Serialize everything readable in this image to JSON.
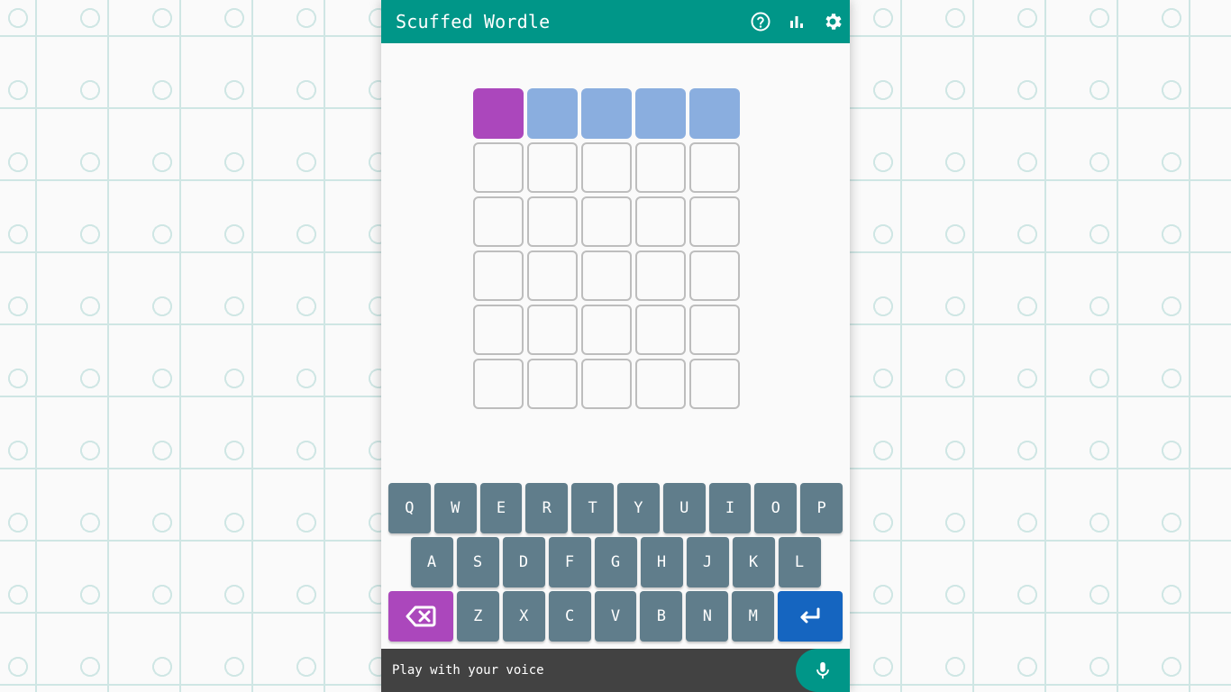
{
  "header": {
    "title": "Scuffed Wordle",
    "icons": [
      "help-icon",
      "stats-icon",
      "settings-icon"
    ]
  },
  "board": {
    "rows": [
      [
        {
          "letter": "",
          "color": "#ab47bc"
        },
        {
          "letter": "",
          "color": "#8aaedf"
        },
        {
          "letter": "",
          "color": "#8aaedf"
        },
        {
          "letter": "",
          "color": "#8aaedf"
        },
        {
          "letter": "",
          "color": "#8aaedf"
        }
      ],
      [
        {
          "letter": ""
        },
        {
          "letter": ""
        },
        {
          "letter": ""
        },
        {
          "letter": ""
        },
        {
          "letter": ""
        }
      ],
      [
        {
          "letter": ""
        },
        {
          "letter": ""
        },
        {
          "letter": ""
        },
        {
          "letter": ""
        },
        {
          "letter": ""
        }
      ],
      [
        {
          "letter": ""
        },
        {
          "letter": ""
        },
        {
          "letter": ""
        },
        {
          "letter": ""
        },
        {
          "letter": ""
        }
      ],
      [
        {
          "letter": ""
        },
        {
          "letter": ""
        },
        {
          "letter": ""
        },
        {
          "letter": ""
        },
        {
          "letter": ""
        }
      ],
      [
        {
          "letter": ""
        },
        {
          "letter": ""
        },
        {
          "letter": ""
        },
        {
          "letter": ""
        },
        {
          "letter": ""
        }
      ]
    ]
  },
  "keyboard": {
    "row1": [
      "Q",
      "W",
      "E",
      "R",
      "T",
      "Y",
      "U",
      "I",
      "O",
      "P"
    ],
    "row2": [
      "A",
      "S",
      "D",
      "F",
      "G",
      "H",
      "J",
      "K",
      "L"
    ],
    "row3": [
      "Z",
      "X",
      "C",
      "V",
      "B",
      "N",
      "M"
    ],
    "backspace_icon": "backspace-icon",
    "enter_icon": "enter-icon"
  },
  "voice": {
    "label": "Play with your voice",
    "icon": "microphone-icon"
  },
  "colors": {
    "header": "#009688",
    "key": "#607d8b",
    "backspace": "#ab47bc",
    "enter": "#1565c0",
    "voicebar": "#424242",
    "empty_tile_border": "#bdbdbd"
  }
}
